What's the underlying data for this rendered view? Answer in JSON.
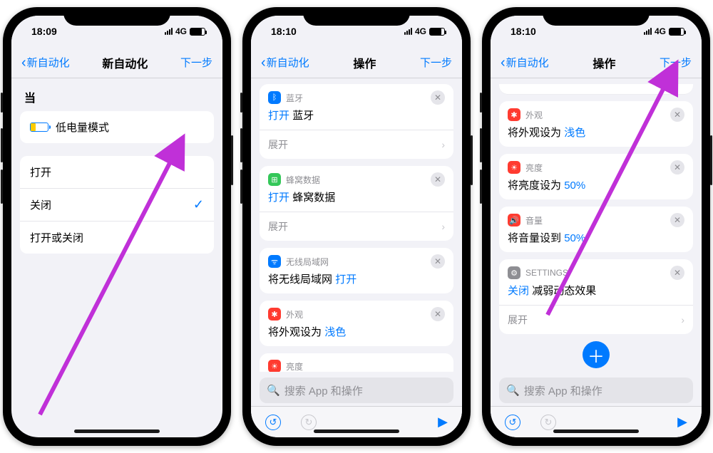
{
  "phone1": {
    "time": "18:09",
    "network": "4G",
    "nav": {
      "back": "新自动化",
      "title": "新自动化",
      "next": "下一步"
    },
    "when_label": "当",
    "trigger": "低电量模式",
    "options": {
      "open": "打开",
      "close": "关闭",
      "toggle": "打开或关闭"
    },
    "selected": "close"
  },
  "phone2": {
    "time": "18:10",
    "network": "4G",
    "nav": {
      "back": "新自动化",
      "title": "操作",
      "next": "下一步"
    },
    "cards": {
      "bt": {
        "app": "蓝牙",
        "line_pre": "打开",
        "line_post": "蓝牙",
        "expand": "展开"
      },
      "cell": {
        "app": "蜂窝数据",
        "line_pre": "打开",
        "line_post": "蜂窝数据",
        "expand": "展开"
      },
      "wifi": {
        "app": "无线局域网",
        "line": "将无线局域网",
        "link": "打开"
      },
      "appr": {
        "app": "外观",
        "line": "将外观设为",
        "link": "浅色"
      },
      "brt": {
        "app": "亮度"
      }
    },
    "search": "搜索 App 和操作"
  },
  "phone3": {
    "time": "18:10",
    "network": "4G",
    "nav": {
      "back": "新自动化",
      "title": "操作",
      "next": "下一步"
    },
    "cards": {
      "appr": {
        "app": "外观",
        "line": "将外观设为",
        "link": "浅色"
      },
      "brt": {
        "app": "亮度",
        "line": "将亮度设为",
        "link": "50%"
      },
      "vol": {
        "app": "音量",
        "line": "将音量设到",
        "link": "50%"
      },
      "set": {
        "app": "SETTINGS",
        "line_pre": "关闭",
        "line_post": "减弱动态效果",
        "expand": "展开"
      }
    },
    "search": "搜索 App 和操作"
  }
}
